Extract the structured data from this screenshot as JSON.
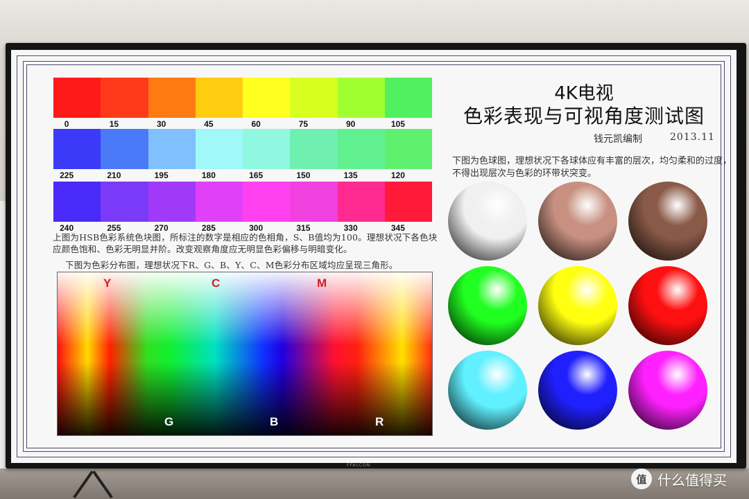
{
  "chart": {
    "title_line1": "4K电视",
    "title_line2": "色彩表现与可视角度测试图",
    "author": "钱元凯编制",
    "date": "2013.11",
    "row1": {
      "colors": [
        "#ff1a1a",
        "#ff3a1a",
        "#ff7a10",
        "#ffcc10",
        "#ffff20",
        "#d8ff20",
        "#a0ff30",
        "#50f060"
      ],
      "labels": [
        "0",
        "15",
        "30",
        "45",
        "60",
        "75",
        "90",
        "105"
      ]
    },
    "row2": {
      "colors": [
        "#3a3af8",
        "#4a7af8",
        "#80c0ff",
        "#a0f8f8",
        "#90f8e0",
        "#70f0b0",
        "#60f090",
        "#60f070"
      ],
      "labels": [
        "225",
        "210",
        "195",
        "180",
        "165",
        "150",
        "135",
        "120"
      ]
    },
    "row3": {
      "colors": [
        "#4a2af8",
        "#7a3af8",
        "#a03af8",
        "#e040f8",
        "#ff40f0",
        "#f040e0",
        "#ff2a90",
        "#ff1a3a"
      ],
      "labels": [
        "240",
        "255",
        "270",
        "285",
        "300",
        "315",
        "330",
        "345"
      ]
    },
    "hsb_desc": "上图为HSB色彩系统色块图，所标注的数字是相应的色相角，S、B值均为100。理想状况下各色块应颜色饱和、色彩无明显并阶。改变观察角度应无明显色彩偏移与明暗变化。",
    "dist_desc": "下图为色彩分布图，理想状况下R、G、B、Y、C、M色彩分布区域均应呈现三角形。",
    "dist_labels_top": [
      "Y",
      "C",
      "M"
    ],
    "dist_labels_bottom": [
      "G",
      "B",
      "R"
    ],
    "ball_desc": "下图为色球图，理想状况下各球体应有丰富的层次，均匀柔和的过度，不得出现层次与色彩的环带状突变。",
    "balls": [
      {
        "name": "white",
        "color": "#f0f0f0"
      },
      {
        "name": "skin",
        "color": "#c89080"
      },
      {
        "name": "brown",
        "color": "#8a5a48"
      },
      {
        "name": "green",
        "color": "#20ff20"
      },
      {
        "name": "yellow",
        "color": "#ffff10"
      },
      {
        "name": "red",
        "color": "#ff1010"
      },
      {
        "name": "cyan",
        "color": "#60f0ff"
      },
      {
        "name": "blue",
        "color": "#2020ff"
      },
      {
        "name": "magenta",
        "color": "#ff20ff"
      }
    ]
  },
  "tv": {
    "brand": "FFALCON"
  },
  "watermark": {
    "logo_text": "值",
    "text": "什么值得买"
  }
}
